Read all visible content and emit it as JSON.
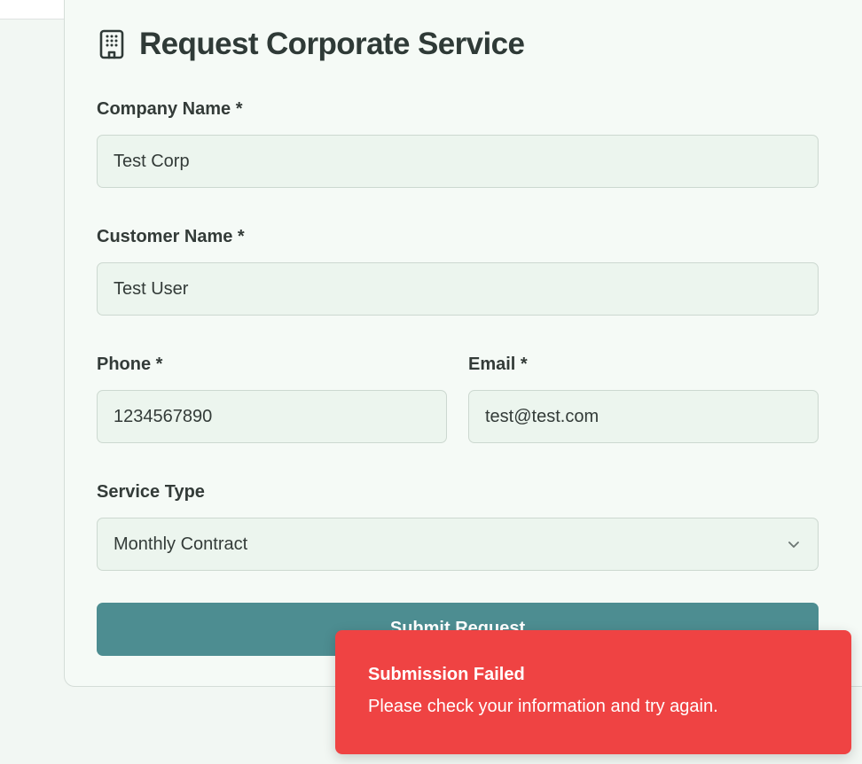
{
  "form": {
    "title": "Request Corporate Service",
    "title_icon": "building-icon",
    "company_label": "Company Name *",
    "company_value": "Test Corp",
    "customer_label": "Customer Name *",
    "customer_value": "Test User",
    "phone_label": "Phone *",
    "phone_value": "1234567890",
    "email_label": "Email *",
    "email_value": "test@test.com",
    "service_label": "Service Type",
    "service_value": "Monthly Contract",
    "service_icon": "chevron-down-icon",
    "submit_label": "Submit Request"
  },
  "toast": {
    "title": "Submission Failed",
    "message": "Please check your information and try again.",
    "color": "#ef4343"
  },
  "colors": {
    "accent": "#4d8d91",
    "background": "#f2f7f3",
    "field_bg": "#ecf5ee"
  }
}
